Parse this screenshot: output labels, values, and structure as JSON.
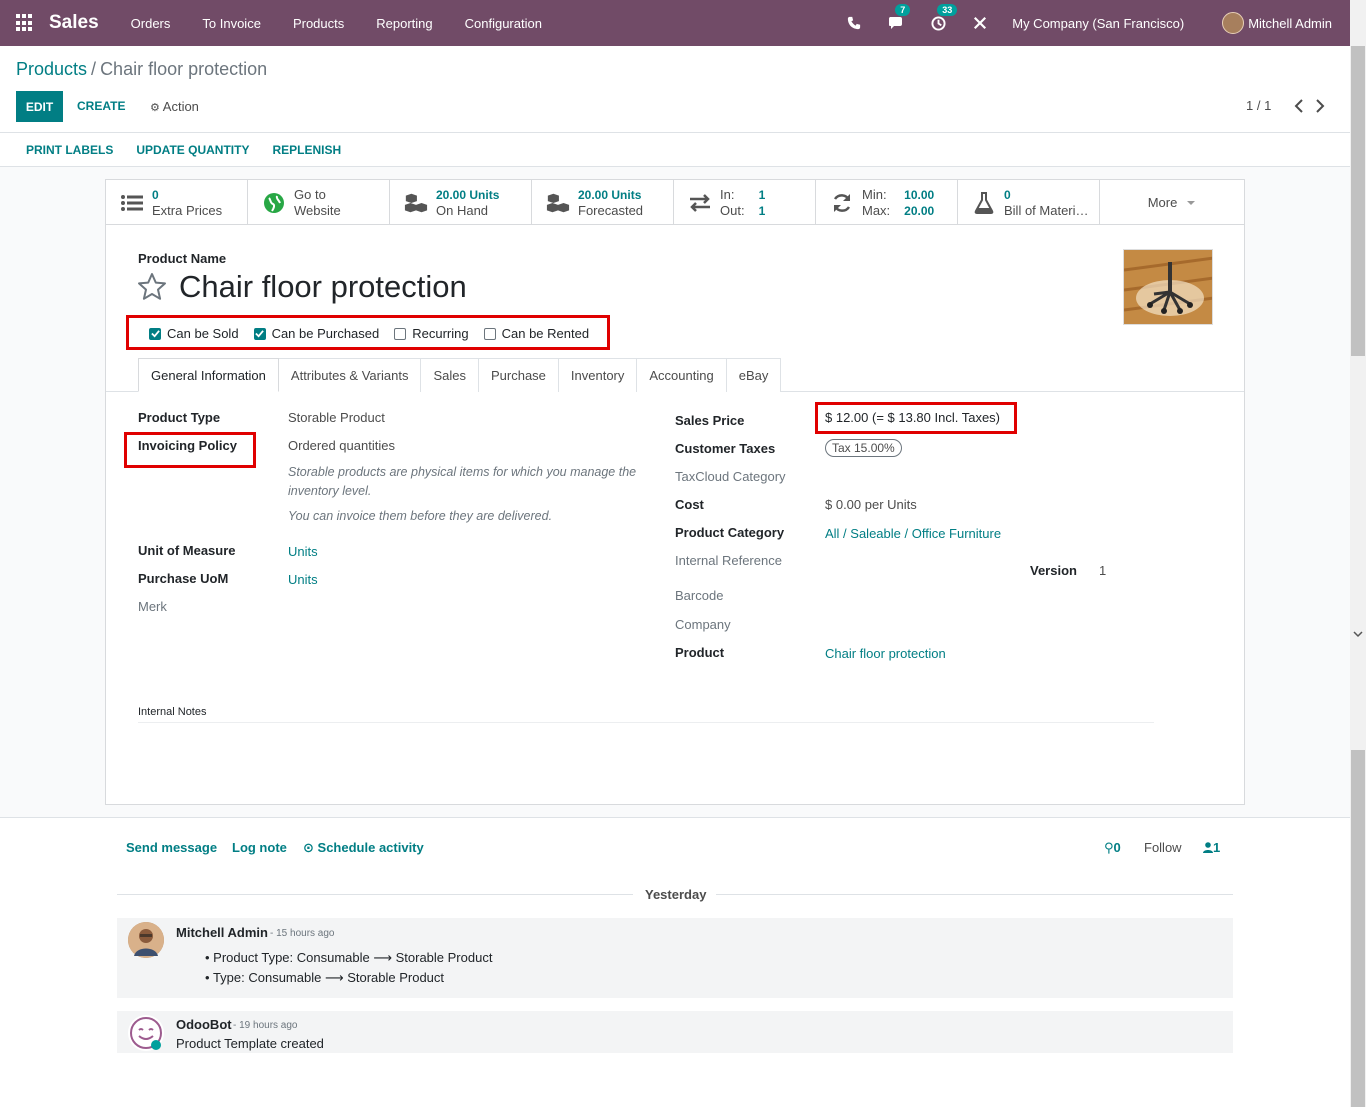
{
  "topnav": {
    "brand": "Sales",
    "menu": [
      "Orders",
      "To Invoice",
      "Products",
      "Reporting",
      "Configuration"
    ],
    "messages_badge": "7",
    "activities_badge": "33",
    "company": "My Company (San Francisco)",
    "user": "Mitchell Admin",
    "color": "#714b67"
  },
  "breadcrumb": {
    "parent": "Products",
    "separator": "/",
    "current": "Chair floor protection"
  },
  "controls": {
    "edit": "EDIT",
    "create": "CREATE",
    "action": "Action",
    "pager": "1 / 1"
  },
  "statusbar": [
    "PRINT LABELS",
    "UPDATE QUANTITY",
    "REPLENISH"
  ],
  "smart_buttons": {
    "extra_prices": {
      "value": "0",
      "label": "Extra Prices"
    },
    "website": {
      "line1": "Go to",
      "line2": "Website"
    },
    "on_hand": {
      "value": "20.00 Units",
      "label": "On Hand"
    },
    "forecasted": {
      "value": "20.00 Units",
      "label": "Forecasted"
    },
    "in_out": {
      "in_label": "In:",
      "in_value": "1",
      "out_label": "Out:",
      "out_value": "1"
    },
    "minmax": {
      "min_label": "Min:",
      "min_value": "10.00",
      "max_label": "Max:",
      "max_value": "20.00"
    },
    "bom": {
      "value": "0",
      "label": "Bill of Materi…"
    },
    "more": "More"
  },
  "product": {
    "name_label": "Product Name",
    "name": "Chair floor protection",
    "checks": [
      {
        "label": "Can be Sold",
        "checked": true
      },
      {
        "label": "Can be Purchased",
        "checked": true
      },
      {
        "label": "Recurring",
        "checked": false
      },
      {
        "label": "Can be Rented",
        "checked": false
      }
    ]
  },
  "tabs": [
    "General Information",
    "Attributes & Variants",
    "Sales",
    "Purchase",
    "Inventory",
    "Accounting",
    "eBay"
  ],
  "left_fields": {
    "product_type_label": "Product Type",
    "product_type": "Storable Product",
    "invoicing_policy_label": "Invoicing Policy",
    "invoicing_policy": "Ordered quantities",
    "help1": "Storable products are physical items for which you manage the inventory level.",
    "help2": "You can invoice them before they are delivered.",
    "uom_label": "Unit of Measure",
    "uom": "Units",
    "purchase_uom_label": "Purchase UoM",
    "purchase_uom": "Units",
    "merk_label": "Merk"
  },
  "right_fields": {
    "sales_price_label": "Sales Price",
    "sales_price": "$ 12.00  (= $ 13.80 Incl. Taxes)",
    "customer_taxes_label": "Customer Taxes",
    "customer_taxes": "Tax 15.00%",
    "taxcloud_label": "TaxCloud Category",
    "cost_label": "Cost",
    "cost": "$ 0.00  per Units",
    "category_label": "Product Category",
    "category": "All / Saleable / Office Furniture",
    "internal_ref_label": "Internal Reference",
    "version_label": "Version",
    "version": "1",
    "barcode_label": "Barcode",
    "company_label": "Company",
    "product_label": "Product",
    "product": "Chair floor protection"
  },
  "notes_label": "Internal Notes",
  "chatter": {
    "send_message": "Send message",
    "log_note": "Log note",
    "schedule": "Schedule activity",
    "attachments": "0",
    "follow": "Follow",
    "followers": "1",
    "day": "Yesterday",
    "messages": [
      {
        "author": "Mitchell Admin",
        "date": "- 15 hours ago",
        "lines": [
          "Product Type: Consumable ⟶ Storable Product",
          "Type: Consumable ⟶ Storable Product"
        ]
      },
      {
        "author": "OdooBot",
        "date": "- 19 hours ago",
        "lines": [
          "Product Template created"
        ]
      }
    ]
  }
}
